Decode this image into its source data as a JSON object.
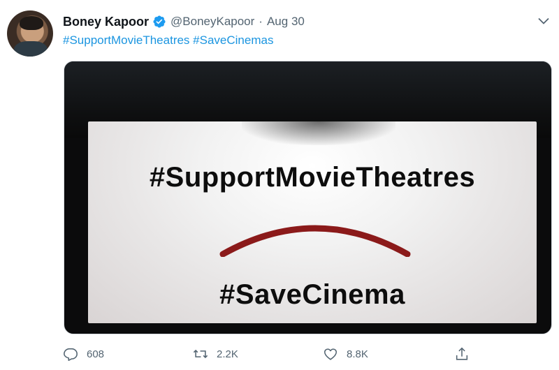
{
  "author": {
    "name": "Boney Kapoor",
    "handle": "@BoneyKapoor",
    "separator": "·",
    "date": "Aug 30"
  },
  "tweet": {
    "hashtags": [
      "#SupportMovieTheatres",
      "#SaveCinemas"
    ]
  },
  "media": {
    "line1": "#SupportMovieTheatres",
    "line2": "#SaveCinema"
  },
  "actions": {
    "reply": {
      "icon": "reply-icon",
      "count": "608"
    },
    "retweet": {
      "icon": "retweet-icon",
      "count": "2.2K"
    },
    "like": {
      "icon": "like-icon",
      "count": "8.8K"
    },
    "share": {
      "icon": "share-icon"
    }
  },
  "colors": {
    "link": "#1b95e0",
    "verified": "#1d9bf0",
    "muted": "#536471",
    "frown": "#8b1a1a"
  }
}
